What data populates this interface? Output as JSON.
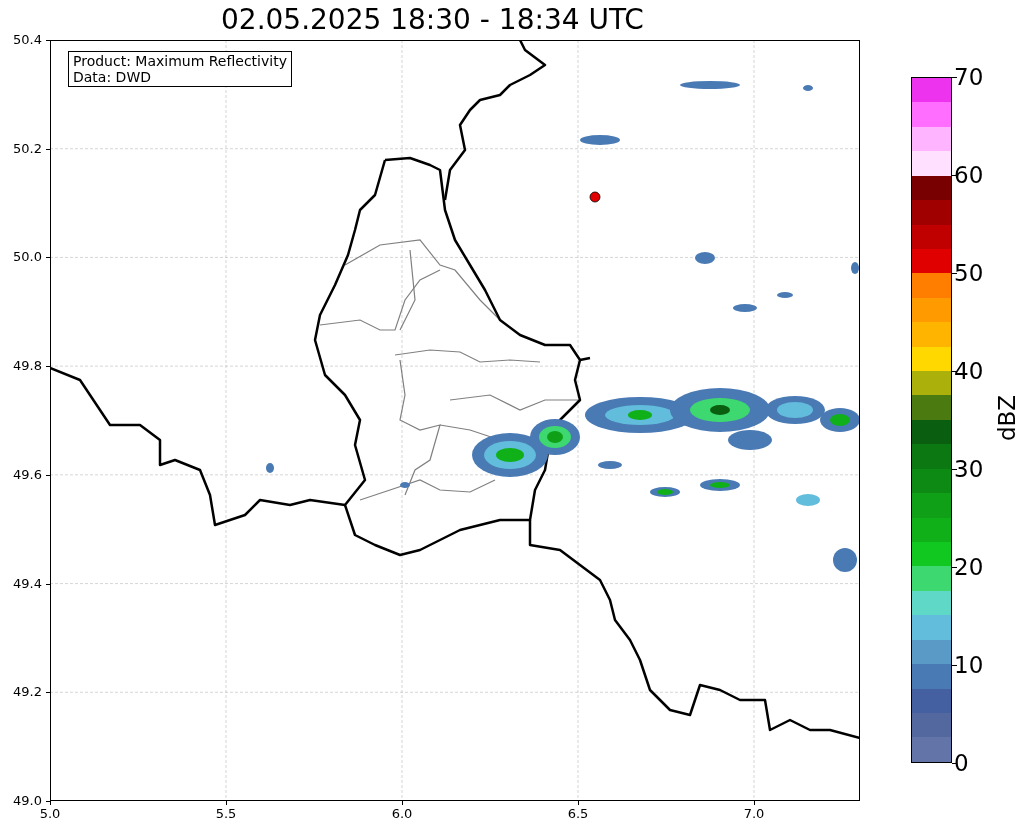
{
  "title": "02.05.2025 18:30 - 18:34 UTC",
  "info_box": [
    "Product: Maximum Reflectivity",
    "Data: DWD"
  ],
  "map": {
    "x_ticks": [
      "5.0",
      "5.5",
      "6.0",
      "6.5",
      "7.0"
    ],
    "y_ticks": [
      "50.4",
      "50.2",
      "50.0",
      "49.8",
      "49.6",
      "49.4",
      "49.2",
      "49.0"
    ]
  },
  "colorbar": {
    "label": "dBZ",
    "ticks": [
      "70",
      "60",
      "50",
      "40",
      "30",
      "20",
      "10",
      "0"
    ],
    "bins": [
      {
        "color": "#ee33ee"
      },
      {
        "color": "#ff6eff"
      },
      {
        "color": "#ffb4ff"
      },
      {
        "color": "#ffe0ff"
      },
      {
        "color": "#780000"
      },
      {
        "color": "#a00000"
      },
      {
        "color": "#c00000"
      },
      {
        "color": "#e00000"
      },
      {
        "color": "#ff7e00"
      },
      {
        "color": "#ff9a00"
      },
      {
        "color": "#ffb400"
      },
      {
        "color": "#ffd800"
      },
      {
        "color": "#acb00a"
      },
      {
        "color": "#4a7a10"
      },
      {
        "color": "#0a5e10"
      },
      {
        "color": "#0c7812"
      },
      {
        "color": "#0c8a14"
      },
      {
        "color": "#10a018"
      },
      {
        "color": "#10b018"
      },
      {
        "color": "#10c820"
      },
      {
        "color": "#3ed870"
      },
      {
        "color": "#60d8c8"
      },
      {
        "color": "#62bcdc"
      },
      {
        "color": "#5a9ac6"
      },
      {
        "color": "#4a7ab4"
      },
      {
        "color": "#4560a0"
      },
      {
        "color": "#5468a0"
      },
      {
        "color": "#6274a8"
      }
    ]
  }
}
